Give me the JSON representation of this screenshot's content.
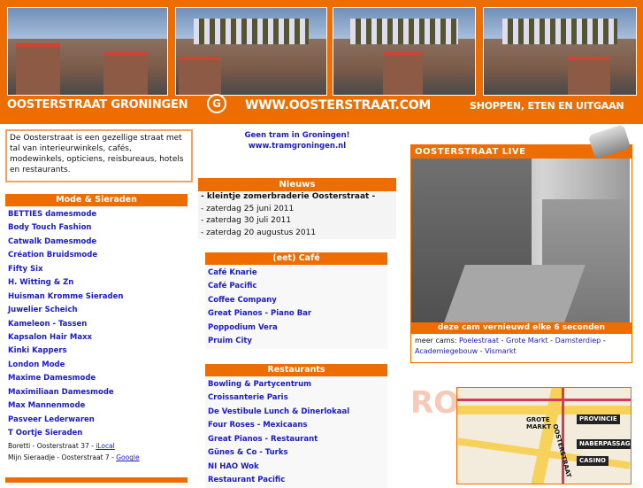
{
  "header": {
    "site_name": "OOSTERSTRAAT GRONINGEN",
    "url": "WWW.OOSTERSTRAAT.COM",
    "tagline": "SHOPPEN, ETEN EN UITGAAN",
    "logo_letter": "G"
  },
  "intro": "De Oosterstraat is een gezellige straat met tal van interieurwinkels, cafés, modewinkels, opticiens, reisbureaus, hotels en restaurants.",
  "tram": {
    "line1": "Geen tram in Groningen!",
    "line2": "www.tramgroningen.nl"
  },
  "mode": {
    "title": "Mode & Sieraden",
    "items": [
      "BETTIES damesmode",
      "Body Touch Fashion",
      "Catwalk Damesmode",
      "Création Bruidsmode",
      "Fifty Six",
      "H. Witting & Zn",
      "Huisman Kromme Sieraden",
      "Juwelier Scheich",
      "Kameleon - Tassen",
      "Kapsalon Hair Maxx",
      "Kinki Kappers",
      "London Mode",
      "Maxime Damesmode",
      "Maximiliaan Damesmode",
      "Max Mannenmode",
      "Pasveer Lederwaren",
      "T Oortje Sieraden"
    ],
    "extra1_text": "Boretti - Oosterstraat 37 - ",
    "extra1_link": "iLocal",
    "extra2_text": "Mijn Sieraadje - Oosterstraat 7 - ",
    "extra2_link": "Google"
  },
  "nieuws": {
    "title": "Nieuws",
    "lines": [
      "- kleintje zomerbraderie Oosterstraat -",
      "- zaterdag 25 juni 2011",
      "- zaterdag 30 juli 2011",
      "- zaterdag 20 augustus 2011"
    ]
  },
  "cafe": {
    "title": "(eet) Café",
    "items": [
      "Café Knarie",
      "Café Pacific",
      "Coffee Company",
      "Great Pianos - Piano Bar",
      "Poppodium Vera",
      "Pruim City"
    ]
  },
  "restaurants": {
    "title": "Restaurants",
    "items": [
      "Bowling & Partycentrum",
      "Croissanterie Paris",
      "De Vestibule Lunch & Dinerlokaal",
      "Four Roses - Mexicaans",
      "Great Pianos - Restaurant",
      "Günes & Co - Turks",
      "NI HAO Wok",
      "Restaurant Pacific"
    ]
  },
  "live": {
    "title": "OOSTERSTRAAT LIVE",
    "caption": "deze cam vernieuwd elke 6 seconden",
    "cams_label": "meer cams: ",
    "cams": [
      "Poelestraat",
      "Grote Markt",
      "Damsterdiep",
      "Academiegebouw",
      "Vismarkt"
    ]
  },
  "map": {
    "side_text": "ROU",
    "labels": [
      "PROVINCIE",
      "NABERPASSAGE",
      "CASINO"
    ],
    "signs": [
      "GROTE MARKT",
      "OOSTERSTRAAT"
    ]
  },
  "colors": {
    "accent": "#ee6d00",
    "link": "#1a1ad0"
  }
}
